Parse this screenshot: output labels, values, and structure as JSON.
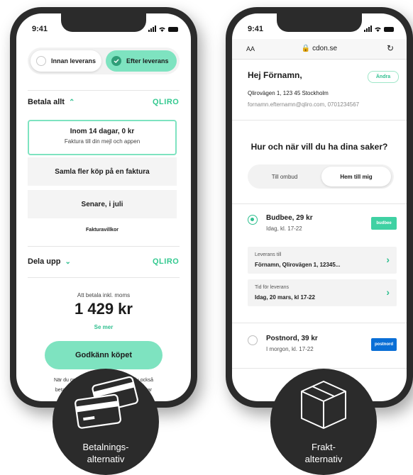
{
  "left_phone": {
    "time": "9:41",
    "segment": {
      "before": "Innan leverans",
      "after": "Efter leverans"
    },
    "pay_all": {
      "title": "Betala allt",
      "brand": "QLIRO"
    },
    "options": [
      {
        "title": "Inom 14 dagar, 0 kr",
        "subtitle": "Faktura till din mejl och appen"
      },
      {
        "title": "Samla fler köp på en faktura"
      },
      {
        "title": "Senare, i juli"
      }
    ],
    "terms_link": "Fakturavillkor",
    "split": {
      "title": "Dela upp",
      "brand": "QLIRO"
    },
    "total_label": "Att betala inkl. moms",
    "total_amount": "1 429 kr",
    "see_more": "Se mer",
    "approve_button": "Godkänn köpet",
    "fine_print": [
      "När du godkänner köpet godkänner du också",
      "betalning och leveransvillkor och accepterar"
    ]
  },
  "right_phone": {
    "time": "9:41",
    "browser": {
      "text_size": "AA",
      "url": "cdon.se"
    },
    "greeting": "Hej Förnamn,",
    "change_button": "Ändra",
    "address": "Qlirovägen 1, 123 45  Stockholm",
    "contact": "fornamn.efternamn@qliro.com, 0701234567",
    "question": "Hur och när vill du ha dina saker?",
    "segment": {
      "pickup": "Till ombud",
      "home": "Hem till mig"
    },
    "shipping": [
      {
        "name": "Budbee, 29 kr",
        "sub": "Idag, kl. 17-22",
        "logo": "budbee",
        "logo_color": "#3fd1a3",
        "selected": true
      },
      {
        "name": "Postnord, 39 kr",
        "sub": "I morgon, kl. 17-22",
        "logo": "postnord",
        "logo_color": "#0a6fd6",
        "selected": false
      }
    ],
    "delivery_to": {
      "label": "Leverans till",
      "value": "Förnamn, Qlirovägen 1, 12345..."
    },
    "delivery_time": {
      "label": "Tid för leverans",
      "value": "Idag, 20 mars, kl 17-22"
    }
  },
  "badges": {
    "left": [
      "Betalnings-",
      "alternativ"
    ],
    "right": [
      "Frakt-",
      "alternativ"
    ]
  },
  "colors": {
    "accent": "#7ee3c0",
    "accent_dark": "#2fbf8f",
    "phone": "#2b2b2b"
  }
}
